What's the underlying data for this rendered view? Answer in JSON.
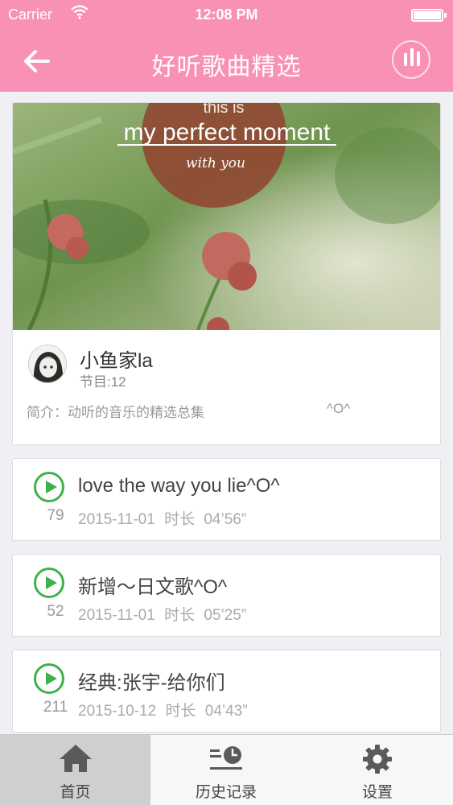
{
  "status_bar": {
    "carrier": "Carrier",
    "time": "12:08 PM"
  },
  "nav": {
    "title": "好听歌曲精选"
  },
  "album": {
    "cover_text": {
      "line1": "this is",
      "line2": "my perfect moment",
      "line3": "with you"
    },
    "owner_name": "小鱼家la",
    "program_count": "节目:12",
    "intro": "简介：动听的音乐的精选总集",
    "intro_suffix": "^O^"
  },
  "songs": [
    {
      "title": "love the way you lie^O^",
      "plays": "79",
      "date": "2015-11-01",
      "duration": "时长 04’56”"
    },
    {
      "title": "新增～日文歌^O^",
      "plays": "52",
      "date": "2015-11-01",
      "duration": "时长 05’25”"
    },
    {
      "title": "经典:张宇-给你们",
      "plays": "211",
      "date": "2015-10-12",
      "duration": "时长 04’43”"
    }
  ],
  "tabs": [
    {
      "label": "首页",
      "icon": "home-icon",
      "active": true
    },
    {
      "label": "历史记录",
      "icon": "history-icon",
      "active": false
    },
    {
      "label": "设置",
      "icon": "gear-icon",
      "active": false
    }
  ],
  "colors": {
    "header": "#f990b5",
    "play": "#3cb24a",
    "tab_active": "#cfcfd1"
  }
}
